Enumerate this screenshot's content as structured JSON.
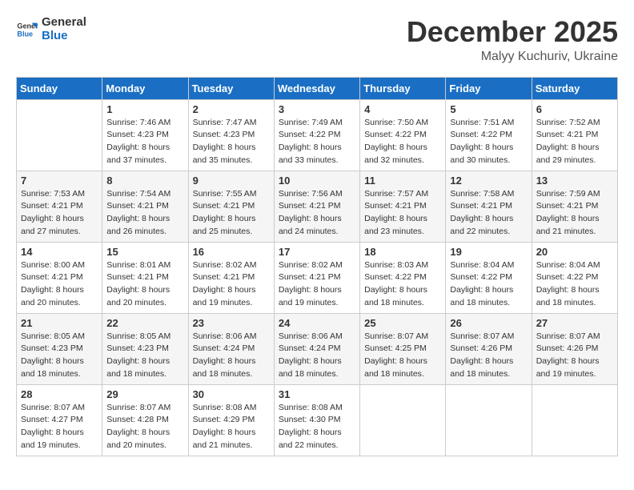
{
  "header": {
    "logo_line1": "General",
    "logo_line2": "Blue",
    "month_year": "December 2025",
    "location": "Malyy Kuchuriv, Ukraine"
  },
  "weekdays": [
    "Sunday",
    "Monday",
    "Tuesday",
    "Wednesday",
    "Thursday",
    "Friday",
    "Saturday"
  ],
  "weeks": [
    [
      {
        "day": null,
        "sunrise": null,
        "sunset": null,
        "daylight": null
      },
      {
        "day": "1",
        "sunrise": "7:46 AM",
        "sunset": "4:23 PM",
        "daylight": "8 hours and 37 minutes."
      },
      {
        "day": "2",
        "sunrise": "7:47 AM",
        "sunset": "4:23 PM",
        "daylight": "8 hours and 35 minutes."
      },
      {
        "day": "3",
        "sunrise": "7:49 AM",
        "sunset": "4:22 PM",
        "daylight": "8 hours and 33 minutes."
      },
      {
        "day": "4",
        "sunrise": "7:50 AM",
        "sunset": "4:22 PM",
        "daylight": "8 hours and 32 minutes."
      },
      {
        "day": "5",
        "sunrise": "7:51 AM",
        "sunset": "4:22 PM",
        "daylight": "8 hours and 30 minutes."
      },
      {
        "day": "6",
        "sunrise": "7:52 AM",
        "sunset": "4:21 PM",
        "daylight": "8 hours and 29 minutes."
      }
    ],
    [
      {
        "day": "7",
        "sunrise": "7:53 AM",
        "sunset": "4:21 PM",
        "daylight": "8 hours and 27 minutes."
      },
      {
        "day": "8",
        "sunrise": "7:54 AM",
        "sunset": "4:21 PM",
        "daylight": "8 hours and 26 minutes."
      },
      {
        "day": "9",
        "sunrise": "7:55 AM",
        "sunset": "4:21 PM",
        "daylight": "8 hours and 25 minutes."
      },
      {
        "day": "10",
        "sunrise": "7:56 AM",
        "sunset": "4:21 PM",
        "daylight": "8 hours and 24 minutes."
      },
      {
        "day": "11",
        "sunrise": "7:57 AM",
        "sunset": "4:21 PM",
        "daylight": "8 hours and 23 minutes."
      },
      {
        "day": "12",
        "sunrise": "7:58 AM",
        "sunset": "4:21 PM",
        "daylight": "8 hours and 22 minutes."
      },
      {
        "day": "13",
        "sunrise": "7:59 AM",
        "sunset": "4:21 PM",
        "daylight": "8 hours and 21 minutes."
      }
    ],
    [
      {
        "day": "14",
        "sunrise": "8:00 AM",
        "sunset": "4:21 PM",
        "daylight": "8 hours and 20 minutes."
      },
      {
        "day": "15",
        "sunrise": "8:01 AM",
        "sunset": "4:21 PM",
        "daylight": "8 hours and 20 minutes."
      },
      {
        "day": "16",
        "sunrise": "8:02 AM",
        "sunset": "4:21 PM",
        "daylight": "8 hours and 19 minutes."
      },
      {
        "day": "17",
        "sunrise": "8:02 AM",
        "sunset": "4:21 PM",
        "daylight": "8 hours and 19 minutes."
      },
      {
        "day": "18",
        "sunrise": "8:03 AM",
        "sunset": "4:22 PM",
        "daylight": "8 hours and 18 minutes."
      },
      {
        "day": "19",
        "sunrise": "8:04 AM",
        "sunset": "4:22 PM",
        "daylight": "8 hours and 18 minutes."
      },
      {
        "day": "20",
        "sunrise": "8:04 AM",
        "sunset": "4:22 PM",
        "daylight": "8 hours and 18 minutes."
      }
    ],
    [
      {
        "day": "21",
        "sunrise": "8:05 AM",
        "sunset": "4:23 PM",
        "daylight": "8 hours and 18 minutes."
      },
      {
        "day": "22",
        "sunrise": "8:05 AM",
        "sunset": "4:23 PM",
        "daylight": "8 hours and 18 minutes."
      },
      {
        "day": "23",
        "sunrise": "8:06 AM",
        "sunset": "4:24 PM",
        "daylight": "8 hours and 18 minutes."
      },
      {
        "day": "24",
        "sunrise": "8:06 AM",
        "sunset": "4:24 PM",
        "daylight": "8 hours and 18 minutes."
      },
      {
        "day": "25",
        "sunrise": "8:07 AM",
        "sunset": "4:25 PM",
        "daylight": "8 hours and 18 minutes."
      },
      {
        "day": "26",
        "sunrise": "8:07 AM",
        "sunset": "4:26 PM",
        "daylight": "8 hours and 18 minutes."
      },
      {
        "day": "27",
        "sunrise": "8:07 AM",
        "sunset": "4:26 PM",
        "daylight": "8 hours and 19 minutes."
      }
    ],
    [
      {
        "day": "28",
        "sunrise": "8:07 AM",
        "sunset": "4:27 PM",
        "daylight": "8 hours and 19 minutes."
      },
      {
        "day": "29",
        "sunrise": "8:07 AM",
        "sunset": "4:28 PM",
        "daylight": "8 hours and 20 minutes."
      },
      {
        "day": "30",
        "sunrise": "8:08 AM",
        "sunset": "4:29 PM",
        "daylight": "8 hours and 21 minutes."
      },
      {
        "day": "31",
        "sunrise": "8:08 AM",
        "sunset": "4:30 PM",
        "daylight": "8 hours and 22 minutes."
      },
      {
        "day": null,
        "sunrise": null,
        "sunset": null,
        "daylight": null
      },
      {
        "day": null,
        "sunrise": null,
        "sunset": null,
        "daylight": null
      },
      {
        "day": null,
        "sunrise": null,
        "sunset": null,
        "daylight": null
      }
    ]
  ]
}
